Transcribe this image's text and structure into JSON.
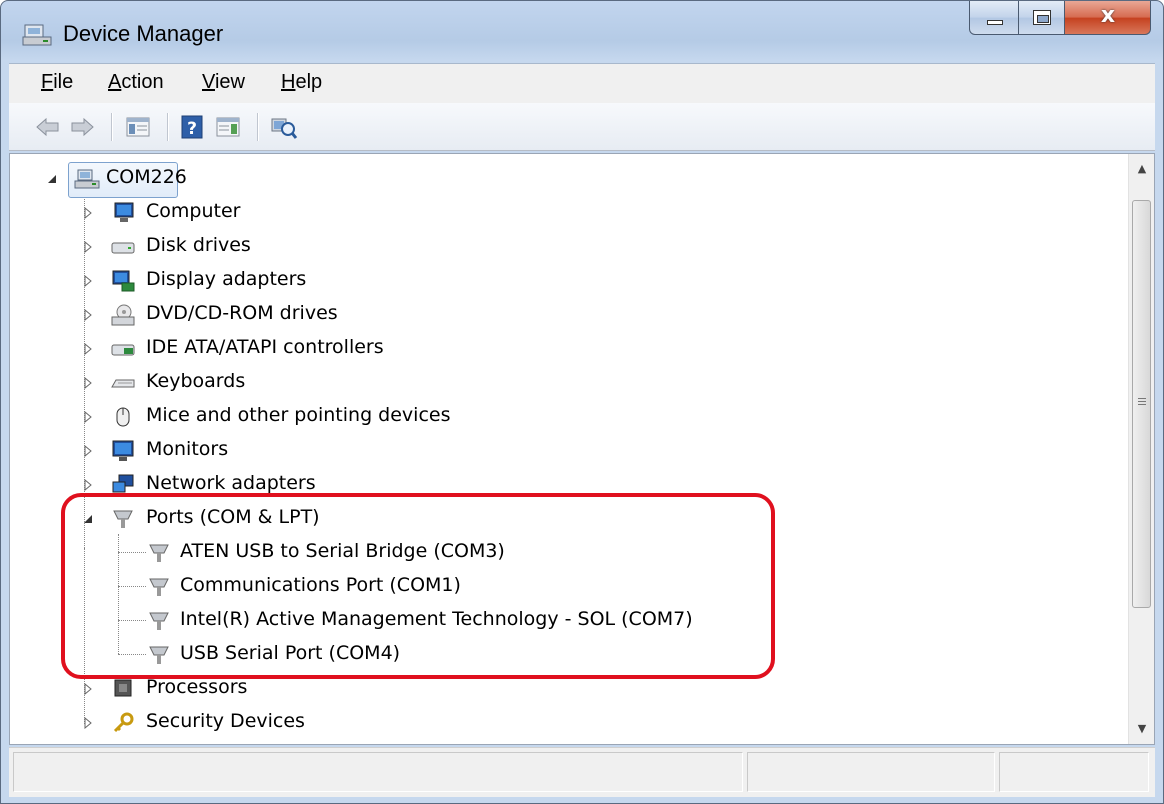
{
  "window": {
    "title": "Device Manager",
    "close_glyph": "x"
  },
  "menu": [
    {
      "key": "F",
      "rest": "ile"
    },
    {
      "key": "A",
      "rest": "ction"
    },
    {
      "key": "V",
      "rest": "iew"
    },
    {
      "key": "H",
      "rest": "elp"
    }
  ],
  "toolbar": {
    "icons": [
      "back-arrow-icon",
      "forward-arrow-icon",
      "show-hide-console-tree-icon",
      "help-icon",
      "properties-pane-icon",
      "scan-hardware-changes-icon"
    ],
    "help_glyph": "?"
  },
  "tree": {
    "root": "COM226",
    "categories": {
      "computer": "Computer",
      "disk": "Disk drives",
      "display": "Display adapters",
      "dvd": "DVD/CD-ROM drives",
      "ide": "IDE ATA/ATAPI controllers",
      "keyboards": "Keyboards",
      "mice": "Mice and other pointing devices",
      "monitors": "Monitors",
      "network": "Network adapters",
      "ports": "Ports (COM & LPT)",
      "processors": "Processors",
      "security": "Security Devices"
    },
    "ports_children": [
      "ATEN USB to Serial Bridge (COM3)",
      "Communications Port (COM1)",
      "Intel(R) Active Management Technology - SOL (COM7)",
      "USB Serial Port (COM4)"
    ]
  },
  "colors": {
    "highlight_outline": "#e0101e",
    "title_bar": "#b5cbe6",
    "close_button": "#c5411f"
  }
}
